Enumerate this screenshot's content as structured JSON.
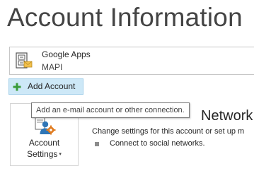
{
  "page": {
    "title": "Account Information"
  },
  "account_selector": {
    "name": "Google Apps",
    "type": "MAPI",
    "icon": "mail-account-icon"
  },
  "add_account": {
    "label": "Add Account",
    "icon": "plus-icon",
    "tooltip": "Add an e-mail account or other connection."
  },
  "account_settings": {
    "line1": "Account",
    "line2": "Settings",
    "chevron": "▾",
    "icon": "account-settings-icon"
  },
  "section": {
    "heading": "Network",
    "description": "Change settings for this account or set up m",
    "bullets": [
      "Connect to social networks."
    ]
  },
  "colors": {
    "accent_hover": "#cde8f7",
    "accent_border": "#a3d0ea",
    "title_text": "#444444",
    "plus_green": "#3a9b3a",
    "settings_blue": "#2e75b6",
    "settings_orange": "#e07b1f"
  }
}
